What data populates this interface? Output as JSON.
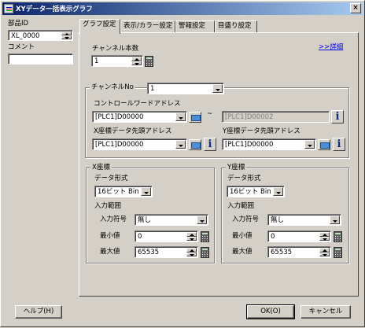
{
  "window": {
    "title": "XYデータ一括表示グラフ",
    "close_label": "×"
  },
  "left_panel": {
    "part_id_label": "部品ID",
    "part_id_value": "XL_0000",
    "comment_label": "コメント",
    "comment_value": ""
  },
  "tabs": [
    {
      "label": "グラフ設定"
    },
    {
      "label": "表示/カラー設定"
    },
    {
      "label": "警報設定"
    },
    {
      "label": "目盛り設定"
    }
  ],
  "graph_settings": {
    "channel_count_label": "チャンネル本数",
    "channel_count_value": "1",
    "details_link": ">>詳細",
    "channel_no_label": "チャンネルNo",
    "channel_no_value": "1",
    "control_word_label": "コントロールワードアドレス",
    "control_word_value": "[PLC1]D00000",
    "range_separator": "~",
    "control_word_end_value": "[PLC1]D00002",
    "x_address_label": "X座標データ先頭アドレス",
    "x_address_value": "[PLC1]D00000",
    "y_address_label": "Y座標データ先頭アドレス",
    "y_address_value": "[PLC1]D00000",
    "x_group": {
      "title": "X座標",
      "data_format_label": "データ形式",
      "data_format_value": "16ビット Bin",
      "input_range_label": "入力範囲",
      "sign_label": "入力符号",
      "sign_value": "無し",
      "min_label": "最小値",
      "min_value": "0",
      "max_label": "最大値",
      "max_value": "65535"
    },
    "y_group": {
      "title": "Y座標",
      "data_format_label": "データ形式",
      "data_format_value": "16ビット Bin",
      "input_range_label": "入力範囲",
      "sign_label": "入力符号",
      "sign_value": "無し",
      "min_label": "最小値",
      "min_value": "0",
      "max_label": "最大値",
      "max_value": "65535"
    }
  },
  "footer": {
    "help_label": "ヘルプ(H)",
    "ok_label": "OK(O)",
    "cancel_label": "キャンセル"
  },
  "icons": {
    "title": "graph-app-icon",
    "calculator": "calculator-icon",
    "keyboard": "address-input-icon",
    "info": "info-icon"
  },
  "colors": {
    "title_start": "#0a246a",
    "title_end": "#a6caf0",
    "face": "#d4d0c8",
    "link": "#0000ee",
    "info": "#0a2e8a"
  }
}
